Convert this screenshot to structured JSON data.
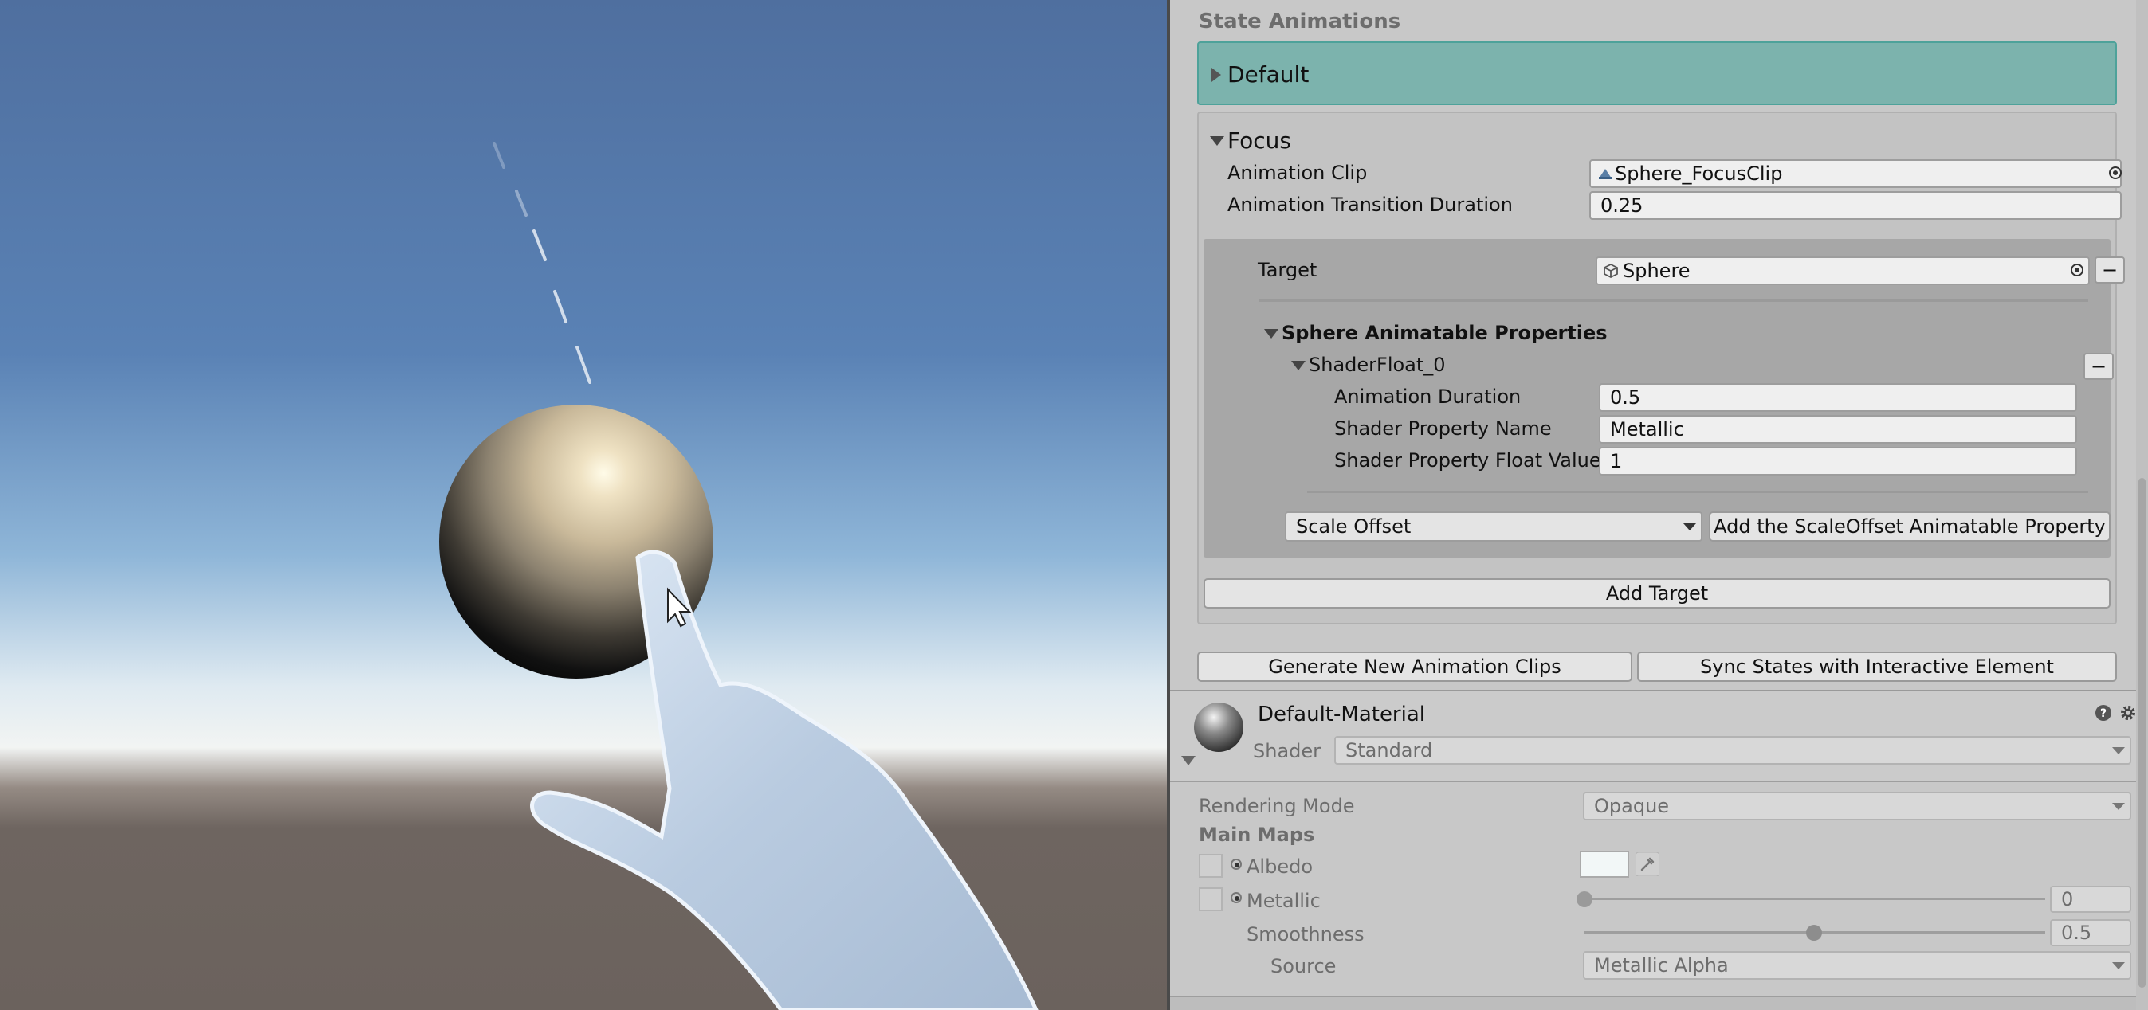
{
  "inspector": {
    "section_title": "State Animations",
    "states": [
      {
        "name": "Default",
        "expanded": false,
        "highlight_color": "#7cb3ad"
      },
      {
        "name": "Focus",
        "expanded": true
      }
    ],
    "focus": {
      "animation_clip_label": "Animation Clip",
      "animation_clip_value": "Sphere_FocusClip",
      "transition_duration_label": "Animation Transition Duration",
      "transition_duration_value": "0.25",
      "target_label": "Target",
      "target_value": "Sphere",
      "animatable_properties_title": "Sphere Animatable Properties",
      "property_group": "ShaderFloat_0",
      "properties": [
        {
          "label": "Animation Duration",
          "value": "0.5"
        },
        {
          "label": "Shader Property Name",
          "value": "Metallic"
        },
        {
          "label": "Shader Property Float Value",
          "value": "1"
        }
      ],
      "property_type_selected": "Scale Offset",
      "add_property_button": "Add the ScaleOffset Animatable Property",
      "add_target_button": "Add Target"
    },
    "generate_button": "Generate New Animation Clips",
    "sync_button": "Sync States with Interactive Element"
  },
  "material": {
    "name": "Default-Material",
    "shader_label": "Shader",
    "shader_value": "Standard",
    "rendering_mode_label": "Rendering Mode",
    "rendering_mode_value": "Opaque",
    "main_maps_label": "Main Maps",
    "albedo_label": "Albedo",
    "albedo_color": "#f2f7f7",
    "metallic_label": "Metallic",
    "metallic_value": "0",
    "smoothness_label": "Smoothness",
    "smoothness_value": "0.5",
    "source_label": "Source",
    "source_value": "Metallic Alpha"
  },
  "scene": {
    "object": "sphere",
    "hand": "hand-pointer"
  }
}
